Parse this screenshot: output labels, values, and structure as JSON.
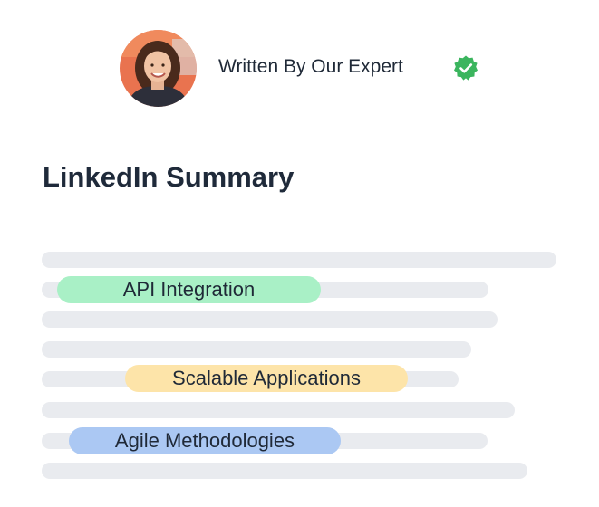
{
  "author": {
    "label": "Written By Our Expert",
    "verified_icon": "verified-badge-icon",
    "verified_color": "#3bb55e"
  },
  "document": {
    "title": "LinkedIn Summary"
  },
  "keywords": [
    {
      "text": "API Integration",
      "color": "#a9f0c6"
    },
    {
      "text": "Scalable Applications",
      "color": "#fde4a9"
    },
    {
      "text": "Agile Methodologies",
      "color": "#abc8f3"
    }
  ],
  "colors": {
    "placeholder_line": "#e9ebef",
    "divider": "#e6e8ec",
    "text": "#1f2937"
  }
}
